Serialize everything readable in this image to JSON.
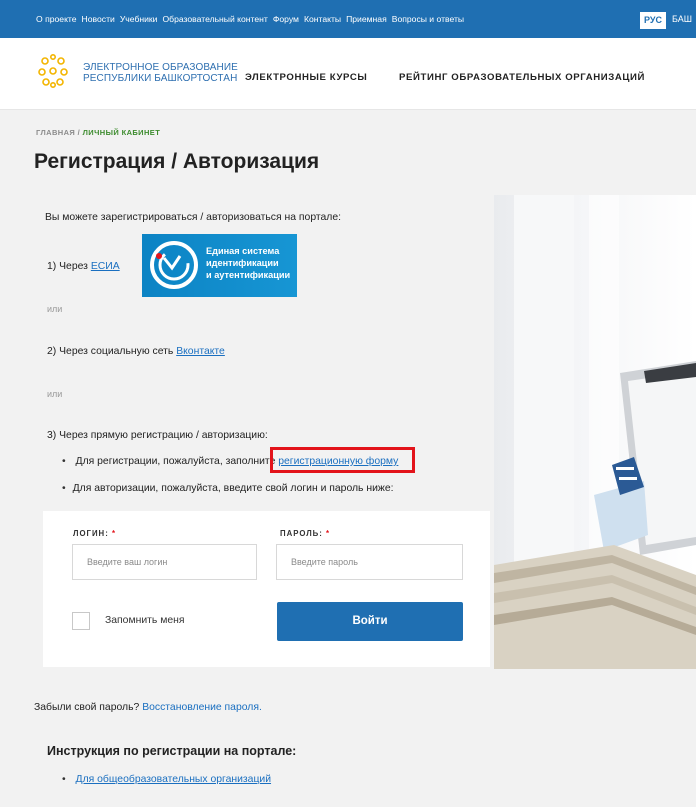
{
  "topbar": {
    "links": [
      "О проекте",
      "Новости",
      "Учебники",
      "Образовательный контент",
      "Форум",
      "Контакты",
      "Приемная",
      "Вопросы и ответы"
    ],
    "lang_active": "РУС",
    "lang_other": "БАШ"
  },
  "header": {
    "brand_line1": "ЭЛЕКТРОННОЕ ОБРАЗОВАНИЕ",
    "brand_line2": "РЕСПУБЛИКИ БАШКОРТОСТАН",
    "nav_courses": "ЭЛЕКТРОННЫЕ КУРСЫ",
    "nav_rating": "РЕЙТИНГ ОБРАЗОВАТЕЛЬНЫХ ОРГАНИЗАЦИЙ"
  },
  "breadcrumb": {
    "home": "ГЛАВНАЯ /",
    "current": "ЛИЧНЫЙ КАБИНЕТ"
  },
  "page_title": "Регистрация / Авторизация",
  "intro": "Вы можете зарегистрироваться / авторизоваться на портале:",
  "option1": {
    "prefix": "1) Через",
    "link": "ЕСИА",
    "esia_line1": "Единая система",
    "esia_line2": "идентификации",
    "esia_line3": "и аутентификации"
  },
  "or_text": "или",
  "option2": {
    "prefix": "2) Через социальную сеть",
    "link": "Вконтакте"
  },
  "option3": {
    "title": "3) Через прямую регистрацию / авторизацию:",
    "bullet1_text": "Для регистрации, пожалуйста, заполните",
    "bullet1_link": "регистрационную форму",
    "bullet2_text": "Для авторизации, пожалуйста, введите свой логин и пароль ниже:"
  },
  "form": {
    "login_label": "ЛОГИН:",
    "password_label": "ПАРОЛЬ:",
    "required_mark": "*",
    "login_placeholder": "Введите ваш логин",
    "password_placeholder": "Введите пароль",
    "remember_label": "Запомнить меня",
    "submit_label": "Войти"
  },
  "forgot": {
    "text": "Забыли свой пароль?",
    "link": "Восстановление пароля."
  },
  "instructions": {
    "title": "Инструкция по регистрации на портале:",
    "item1": "Для общеобразовательных организаций"
  },
  "colors": {
    "primary": "#1f6fb2",
    "link": "#1a6fc0",
    "breadcrumb_active": "#3d8c2e",
    "highlight_box": "#e3141b",
    "logo_yellow": "#f3b500"
  }
}
